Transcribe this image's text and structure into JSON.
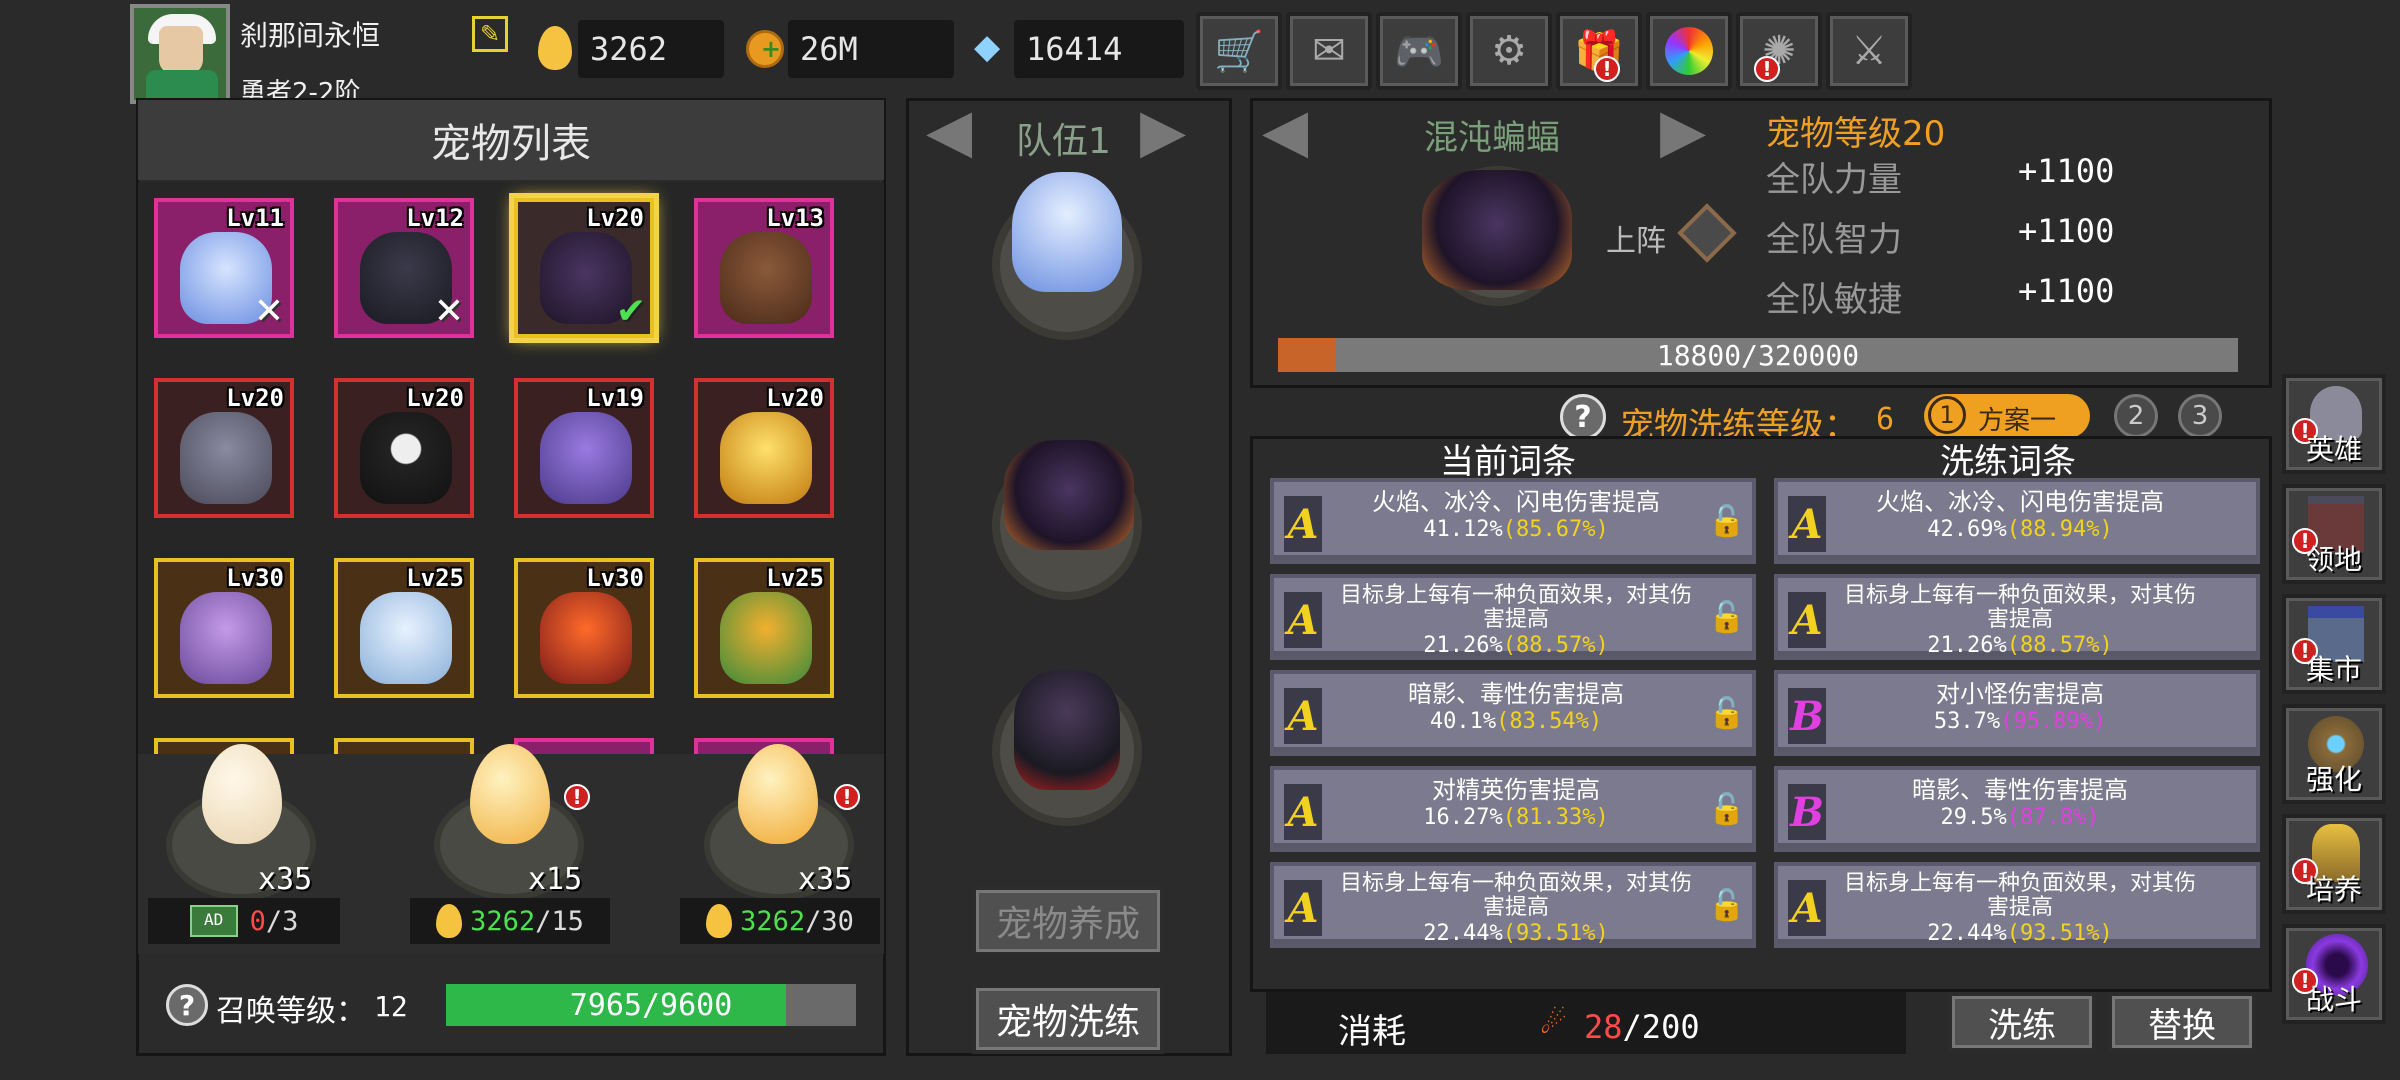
{
  "player": {
    "name": "刹那间永恒",
    "rank": "勇者2-2阶"
  },
  "resources": {
    "eggs": "3262",
    "gold": "26M",
    "diamonds": "16414"
  },
  "pet_list": {
    "title": "宠物列表",
    "pets": [
      {
        "lv": "Lv11",
        "status": "x"
      },
      {
        "lv": "Lv12",
        "status": "x"
      },
      {
        "lv": "Lv20",
        "status": "check"
      },
      {
        "lv": "Lv13",
        "status": ""
      },
      {
        "lv": "Lv20",
        "status": ""
      },
      {
        "lv": "Lv20",
        "status": ""
      },
      {
        "lv": "Lv19",
        "status": ""
      },
      {
        "lv": "Lv20",
        "status": ""
      },
      {
        "lv": "Lv30",
        "status": ""
      },
      {
        "lv": "Lv25",
        "status": ""
      },
      {
        "lv": "Lv30",
        "status": ""
      },
      {
        "lv": "Lv25",
        "status": ""
      }
    ]
  },
  "eggs_section": {
    "egg1": {
      "count": "x35",
      "cost_used": "0",
      "cost_max": "/3"
    },
    "egg2": {
      "count": "x15",
      "cost_used": "3262",
      "cost_max": "/15"
    },
    "egg3": {
      "count": "x35",
      "cost_used": "3262",
      "cost_max": "/30"
    }
  },
  "summon": {
    "label": "召唤等级：",
    "level": "12",
    "progress_text": "7965/9600",
    "progress": 0.83
  },
  "team": {
    "title": "队伍1",
    "train_btn": "宠物养成",
    "wash_btn": "宠物洗练"
  },
  "pet_detail": {
    "name": "混沌蝙蝠",
    "level_label": "宠物等级20",
    "deploy": "上阵",
    "stats": [
      {
        "label": "全队力量",
        "value": "+1100"
      },
      {
        "label": "全队智力",
        "value": "+1100"
      },
      {
        "label": "全队敏捷",
        "value": "+1100"
      }
    ],
    "exp_text": "18800/320000",
    "exp_progress": 0.06
  },
  "wash": {
    "title": "宠物洗练等级：",
    "level": "6",
    "plan_num": "1",
    "plan_label": "方案一",
    "plan2": "2",
    "plan3": "3",
    "current_header": "当前词条",
    "new_header": "洗练词条",
    "current": [
      {
        "grade": "A",
        "text": "火焰、冰冷、闪电伤害提高",
        "val": "41.12%",
        "pct": "(85.67%)"
      },
      {
        "grade": "A",
        "text": "目标身上每有一种负面效果，对其伤害提高",
        "val": "21.26%",
        "pct": "(88.57%)"
      },
      {
        "grade": "A",
        "text": "暗影、毒性伤害提高",
        "val": "40.1%",
        "pct": "(83.54%)"
      },
      {
        "grade": "A",
        "text": "对精英伤害提高",
        "val": "16.27%",
        "pct": "(81.33%)"
      },
      {
        "grade": "A",
        "text": "目标身上每有一种负面效果，对其伤害提高",
        "val": "22.44%",
        "pct": "(93.51%)"
      }
    ],
    "new": [
      {
        "grade": "A",
        "text": "火焰、冰冷、闪电伤害提高",
        "val": "42.69%",
        "pct": "(88.94%)"
      },
      {
        "grade": "A",
        "text": "目标身上每有一种负面效果，对其伤害提高",
        "val": "21.26%",
        "pct": "(88.57%)"
      },
      {
        "grade": "B",
        "text": "对小怪伤害提高",
        "val": "53.7%",
        "pct": "(95.89%)"
      },
      {
        "grade": "B",
        "text": "暗影、毒性伤害提高",
        "val": "29.5%",
        "pct": "(87.8%)"
      },
      {
        "grade": "A",
        "text": "目标身上每有一种负面效果，对其伤害提高",
        "val": "22.44%",
        "pct": "(93.51%)"
      }
    ],
    "cost_label": "消耗",
    "cost_used": "28",
    "cost_max": "/200",
    "wash_btn": "洗练",
    "replace_btn": "替换"
  },
  "side_menu": [
    "英雄",
    "领地",
    "集市",
    "强化",
    "培养",
    "战斗"
  ],
  "colors": {
    "grade_a": "#f2d21e",
    "grade_b": "#e040e0",
    "accent_orange": "#f0a020",
    "green": "#2fb84a"
  }
}
